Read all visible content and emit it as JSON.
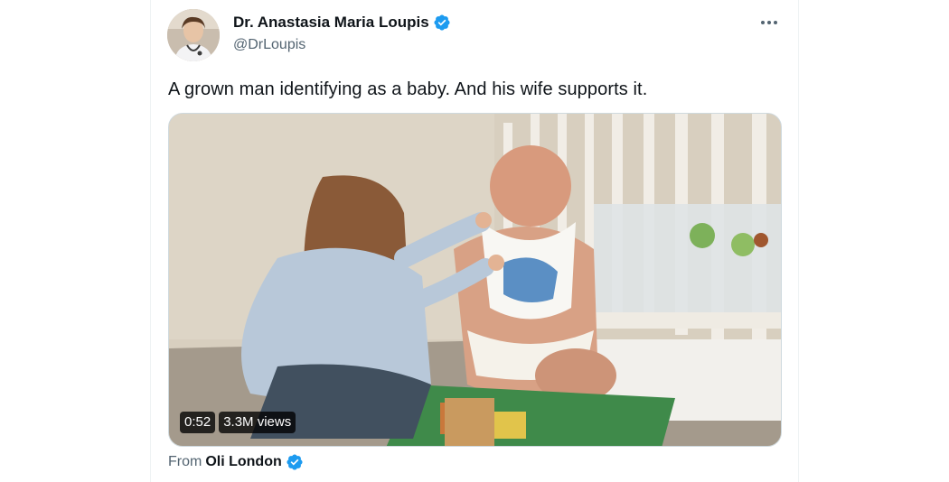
{
  "tweet": {
    "author": {
      "display_name": "Dr. Anastasia Maria Loupis",
      "handle": "@DrLoupis",
      "verified": true,
      "avatar_icon": "profile-photo-avatar"
    },
    "more_icon": "more-options-icon",
    "text": "A grown man identifying as a baby. And his wife supports it.",
    "media": {
      "type": "video",
      "duration": "0:52",
      "views": "3.3M views"
    },
    "attribution": {
      "label": "From",
      "source_name": "Oli London",
      "verified": true
    }
  },
  "colors": {
    "verified_blue": "#1d9bf0",
    "text_primary": "#0f1419",
    "text_secondary": "#536471",
    "border": "#eff3f4"
  }
}
